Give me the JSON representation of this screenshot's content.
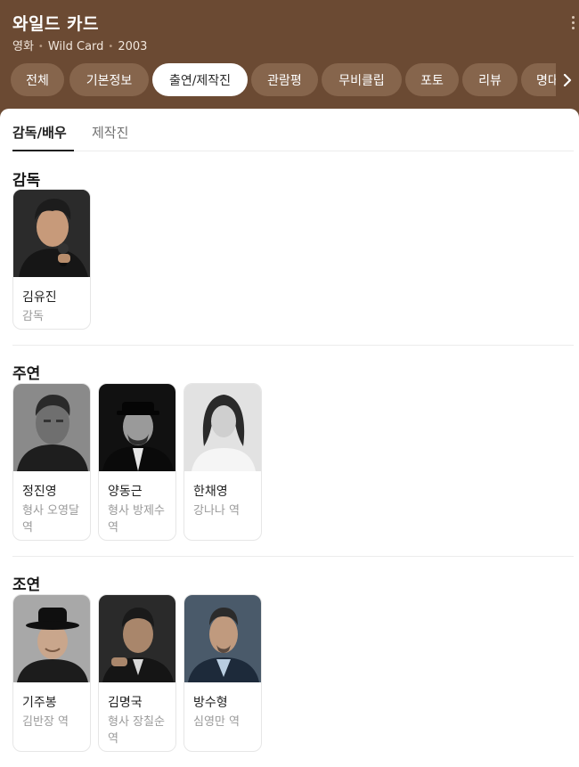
{
  "header": {
    "title": "와일드 카드",
    "genre": "영화",
    "original_title": "Wild Card",
    "year": "2003"
  },
  "tabs": [
    {
      "label": "전체",
      "active": false
    },
    {
      "label": "기본정보",
      "active": false
    },
    {
      "label": "출연/제작진",
      "active": true
    },
    {
      "label": "관람평",
      "active": false
    },
    {
      "label": "무비클립",
      "active": false
    },
    {
      "label": "포토",
      "active": false
    },
    {
      "label": "리뷰",
      "active": false
    },
    {
      "label": "명대",
      "active": false
    }
  ],
  "subtabs": [
    {
      "label": "감독/배우",
      "active": true
    },
    {
      "label": "제작진",
      "active": false
    }
  ],
  "sections": [
    {
      "title": "감독",
      "people": [
        {
          "name": "김유진",
          "role": "감독"
        }
      ]
    },
    {
      "title": "주연",
      "people": [
        {
          "name": "정진영",
          "role": "형사 오영달 역"
        },
        {
          "name": "양동근",
          "role": "형사 방제수 역"
        },
        {
          "name": "한채영",
          "role": "강나나 역"
        }
      ]
    },
    {
      "title": "조연",
      "people": [
        {
          "name": "기주봉",
          "role": "김반장 역"
        },
        {
          "name": "김명국",
          "role": "형사 장칠순 역"
        },
        {
          "name": "방수형",
          "role": "심영만 역"
        }
      ]
    }
  ],
  "colors": {
    "header_bg": "#6b4a33",
    "tab_bg": "#86654c",
    "tab_active_bg": "#ffffff"
  }
}
